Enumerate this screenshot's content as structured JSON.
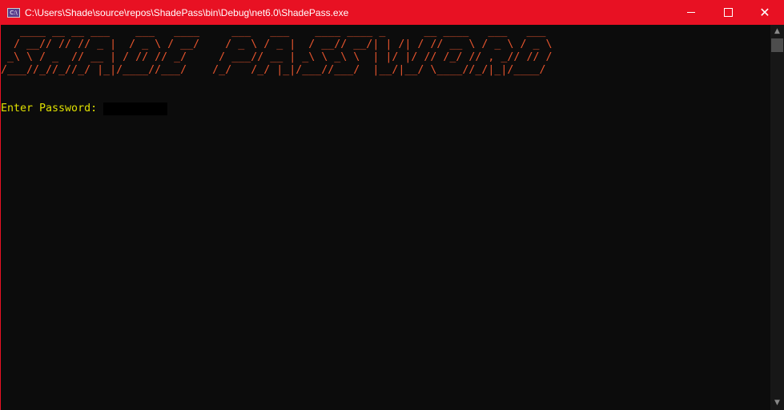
{
  "window": {
    "title": "C:\\Users\\Shade\\source\\repos\\ShadePass\\bin\\Debug\\net6.0\\ShadePass.exe",
    "icon_label": "C:\\",
    "controls": {
      "minimize": "minimize-icon",
      "maximize": "maximize-icon",
      "close": "✕"
    }
  },
  "console": {
    "banner_text": "SHADE PASSWORD",
    "banner_art": "   ____ __ __ ___    ___   ____     ___   ___    ____ ____ _      __ ____   ___   ___ \n  / __// // // _ |  / _ \\ / __/    / _ \\ / _ |  / __// __/| | /| / // __ \\ / _ \\ / _ \\\n _\\ \\ / _  // __ | / // // _/     / ___// __ | _\\ \\ _\\ \\  | |/ |/ // /_/ // , _// // /\n/___//_//_//_/ |_|/____//___/    /_/   /_/ |_|/___//___/  |__/|__/ \\____//_/|_|/____/ ",
    "prompt": "Enter Password: ",
    "colors": {
      "banner": "#e8552e",
      "prompt": "#dfe000",
      "background": "#0c0c0c",
      "titlebar": "#e81123"
    }
  }
}
